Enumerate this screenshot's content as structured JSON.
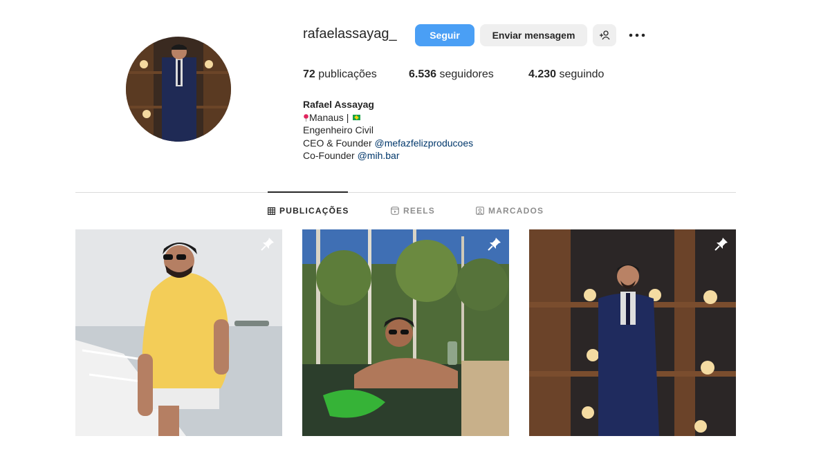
{
  "profile": {
    "username": "rafaelassayag_",
    "follow_label": "Seguir",
    "message_label": "Enviar mensagem",
    "stats": {
      "posts_count": "72",
      "posts_label": "publicações",
      "followers_count": "6.536",
      "followers_label": "seguidores",
      "following_count": "4.230",
      "following_label": "seguindo"
    },
    "bio": {
      "name": "Rafael Assayag",
      "location_text": "Manaus |",
      "line2": "Engenheiro Civil",
      "line3_prefix": "CEO & Founder",
      "line3_link": "@mefazfelizproducoes",
      "line4_prefix": "Co-Founder",
      "line4_link": "@mih.bar"
    }
  },
  "tabs": [
    {
      "label": "PUBLICAÇÕES",
      "icon": "grid-icon",
      "active": true
    },
    {
      "label": "REELS",
      "icon": "reels-icon",
      "active": false
    },
    {
      "label": "MARCADOS",
      "icon": "tagged-icon",
      "active": false
    }
  ],
  "posts": [
    {
      "description_icon": "pin-icon",
      "pinned": true
    },
    {
      "description_icon": "pin-icon",
      "pinned": true
    },
    {
      "description_icon": "pin-icon",
      "pinned": true
    }
  ],
  "colors": {
    "primary_button": "#4a9ff5",
    "secondary_button": "#efefef",
    "link": "#00376b",
    "text": "#262626",
    "muted": "#8e8e8e"
  }
}
